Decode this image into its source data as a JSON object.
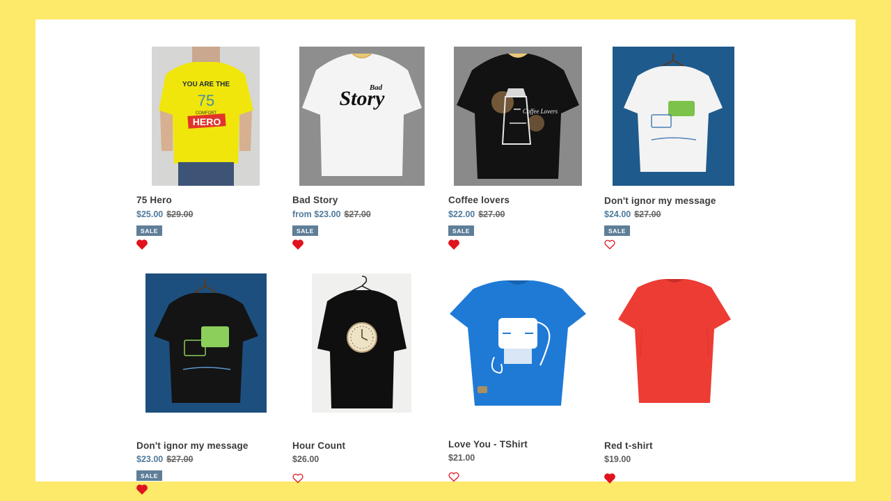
{
  "products": [
    {
      "title": "75 Hero",
      "price": "$25.00",
      "compare": "$29.00",
      "badge": "SALE",
      "favorited": true
    },
    {
      "title": "Bad Story",
      "price": "from $23.00",
      "compare": "$27.00",
      "badge": "SALE",
      "favorited": true
    },
    {
      "title": "Coffee lovers",
      "price": "$22.00",
      "compare": "$27.00",
      "badge": "SALE",
      "favorited": true
    },
    {
      "title": "Don't ignor my message",
      "price": "$24.00",
      "compare": "$27.00",
      "badge": "SALE",
      "favorited": false
    },
    {
      "title": "Don't ignor my message",
      "price": "$23.00",
      "compare": "$27.00",
      "badge": "SALE",
      "favorited": true
    },
    {
      "title": "Hour Count",
      "price": "$26.00",
      "favorited": false
    },
    {
      "title": "Love You - TShirt",
      "price": "$21.00",
      "favorited": false
    },
    {
      "title": "Red t-shirt",
      "price": "$19.00",
      "favorited": true
    }
  ],
  "images": {
    "hero_line1": "YOU ARE THE",
    "hero_number": "75",
    "hero_brand": "COMFORT",
    "hero_word": "HERO",
    "badstory_small": "Bad",
    "badstory_big": "Story",
    "coffee_text": "Coffee Lovers"
  },
  "colors": {
    "background": "#fde96a",
    "sale_badge": "#5f7e98",
    "sale_price": "#4f7a9c",
    "heart": "#e0141e"
  }
}
